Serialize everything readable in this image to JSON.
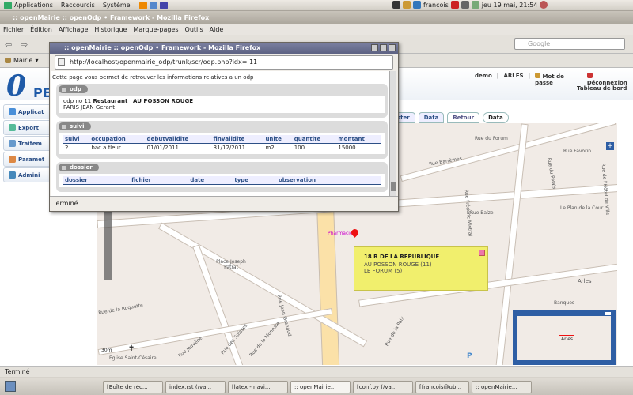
{
  "top_panel": {
    "menus": [
      "Applications",
      "Raccourcis",
      "Système"
    ],
    "user": "francois",
    "clock": "jeu 19 mai, 21:54"
  },
  "browser": {
    "title": ":: openMairie :: openOdp • Framework - Mozilla Firefox",
    "menu": [
      "Fichier",
      "Édition",
      "Affichage",
      "Historique",
      "Marque-pages",
      "Outils",
      "Aide"
    ],
    "search_placeholder": "Google",
    "bookmark": "Mairie",
    "status": "Terminé"
  },
  "app": {
    "logo": "0",
    "logo_rest": "PE",
    "user": "demo",
    "city": "ARLES",
    "password_link": "Mot de passe",
    "logout_link": "Déconnexion",
    "dashboard_link": "Tableau de bord",
    "nav": [
      "Applicat",
      "Export",
      "Traitem",
      "Paramet",
      "Admini"
    ],
    "tabs": [
      "ster",
      "Data",
      "Retour",
      "Data"
    ]
  },
  "map": {
    "streets": [
      "Rue du Forum",
      "Rue Favorin",
      "Rue Barrèmes",
      "Rue du Palais",
      "Rue de l'Hôtel de Ville",
      "Rue Frédéric Mistral",
      "Rue Balze",
      "Le Plan de la Cour",
      "Rue de la Roquette",
      "Place Joseph Patrat",
      "Rue Jean Granaud",
      "Rue de la Monnaie",
      "Rue de la Paix",
      "Rue des Suisses",
      "Rue Jouvène",
      "Arles",
      "Banques",
      "Pharmacie",
      "Église Saint-Césaire"
    ],
    "popup": {
      "title": "18 R DE LA REPUBLIQUE",
      "line1": "AU POSSON ROUGE (11)",
      "line2": "LE FORUM (5)"
    },
    "scale": "30m"
  },
  "popup_window": {
    "title": ":: openMairie :: openOdp • Framework - Mozilla Firefox",
    "url": "http://localhost/openmairie_odp/trunk/scr/odp.php?idx= 11",
    "intro": "Cette page vous permet de retrouver les informations relatives a un odp",
    "odp_section": "odp",
    "odp_line": "odp no 11",
    "odp_type": "Restaurant",
    "odp_name": "AU POSSON ROUGE",
    "odp_owner": "PARIS JEAN Gerant",
    "suivi_section": "suivi",
    "suivi_headers": [
      "suivi",
      "occupation",
      "debutvalidite",
      "finvalidite",
      "unite",
      "quantite",
      "montant"
    ],
    "suivi_rows": [
      [
        "2",
        "bac a fleur",
        "01/01/2011",
        "31/12/2011",
        "m2",
        "100",
        "15000"
      ]
    ],
    "dossier_section": "dossier",
    "dossier_headers": [
      "dossier",
      "fichier",
      "date",
      "type",
      "observation"
    ],
    "status": "Terminé"
  },
  "taskbar": {
    "items": [
      "[Boîte de réc...",
      "index.rst (/va...",
      "[latex - navi...",
      ":: openMairie...",
      "[conf.py (/va...",
      "[francois@ub...",
      ":: openMairie..."
    ]
  }
}
